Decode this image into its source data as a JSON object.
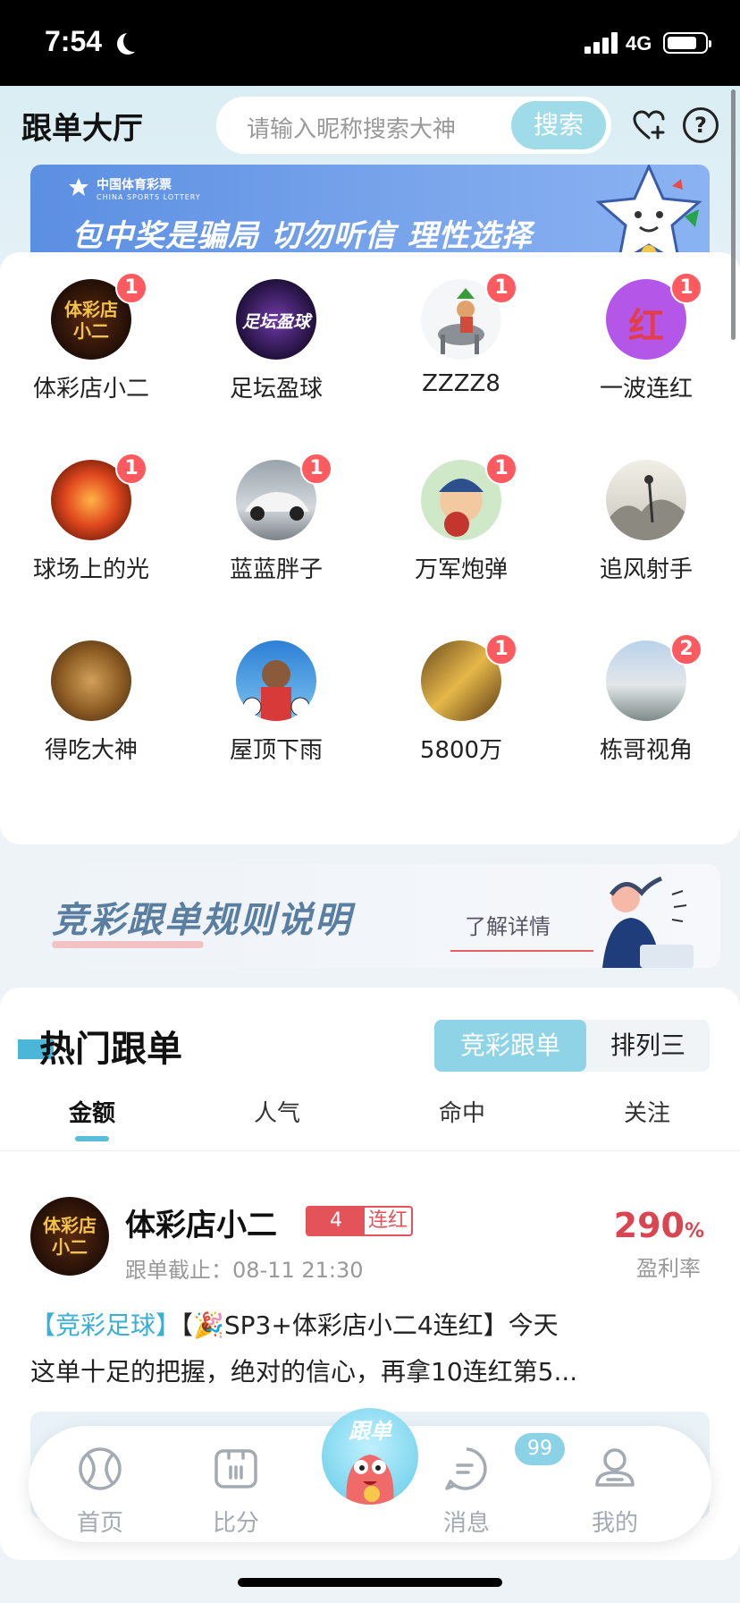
{
  "status_bar": {
    "time": "7:54",
    "network": "4G"
  },
  "header": {
    "title": "跟单大厅",
    "search_placeholder": "请输入昵称搜索大神",
    "search_button": "搜索"
  },
  "banner": {
    "logo_cn": "中国体育彩票",
    "logo_en": "CHINA SPORTS LOTTERY",
    "text": "包中奖是骗局  切勿听信  理性选择"
  },
  "experts": [
    {
      "name": "体彩店小二",
      "badge": "1",
      "avatar_text": "体彩店\n小二"
    },
    {
      "name": "足坛盈球",
      "badge": "",
      "avatar_text": "足坛盈球"
    },
    {
      "name": "ZZZZ8",
      "badge": "1",
      "avatar_text": ""
    },
    {
      "name": "一波连红",
      "badge": "1",
      "avatar_text": "红"
    },
    {
      "name": "球场上的光",
      "badge": "1",
      "avatar_text": ""
    },
    {
      "name": "蓝蓝胖子",
      "badge": "1",
      "avatar_text": ""
    },
    {
      "name": "万军炮弹",
      "badge": "1",
      "avatar_text": ""
    },
    {
      "name": "追风射手",
      "badge": "",
      "avatar_text": ""
    },
    {
      "name": "得吃大神",
      "badge": "",
      "avatar_text": ""
    },
    {
      "name": "屋顶下雨",
      "badge": "",
      "avatar_text": ""
    },
    {
      "name": "5800万",
      "badge": "1",
      "avatar_text": ""
    },
    {
      "name": "栋哥视角",
      "badge": "2",
      "avatar_text": ""
    }
  ],
  "rule_banner": {
    "title": "竞彩跟单规则说明",
    "link": "了解详情"
  },
  "hot": {
    "title": "热门跟单",
    "segments": [
      "竞彩跟单",
      "排列三"
    ],
    "sort_tabs": [
      "金额",
      "人气",
      "命中",
      "关注"
    ]
  },
  "post": {
    "name": "体彩店小二",
    "streak_num": "4",
    "streak_label": "连红",
    "deadline": "跟单截止：08-11 21:30",
    "profit_value": "290",
    "profit_unit": "%",
    "profit_label": "盈利率",
    "tag": "【竞彩足球】",
    "text_1": "【🎉SP3+体彩店小二4连红】今天",
    "text_2": "这单十足的把握，绝对的信心，再拿10连红第5..."
  },
  "tabbar": {
    "home": "首页",
    "score": "比分",
    "center": "跟单",
    "messages": "消息",
    "messages_badge": "99",
    "mine": "我的"
  }
}
